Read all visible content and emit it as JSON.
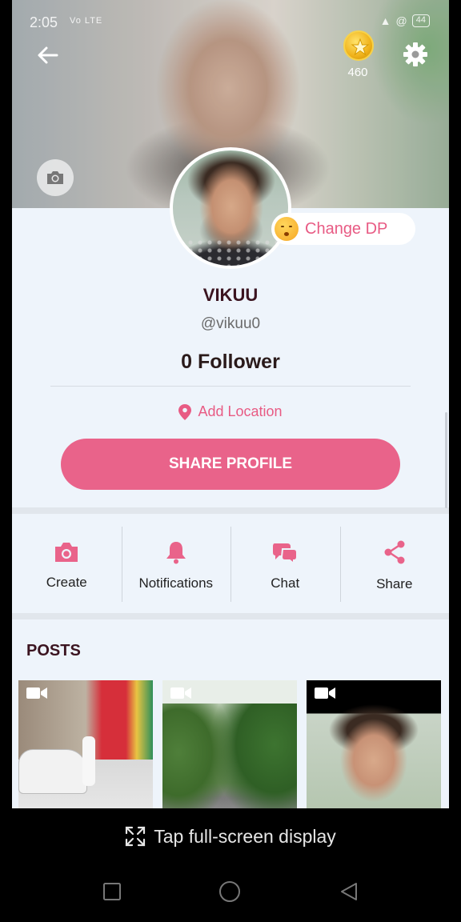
{
  "status_bar": {
    "time": "2:05",
    "signal_text": "Vo LTE",
    "battery": "44"
  },
  "header": {
    "coins": "460"
  },
  "profile": {
    "change_dp_label": "Change DP",
    "name": "VIKUU",
    "handle": "@vikuu0",
    "followers": "0 Follower",
    "location_label": "Add Location",
    "share_button": "SHARE PROFILE"
  },
  "actions": [
    {
      "label": "Create",
      "icon": "camera-icon"
    },
    {
      "label": "Notifications",
      "icon": "bell-icon"
    },
    {
      "label": "Chat",
      "icon": "chat-icon"
    },
    {
      "label": "Share",
      "icon": "share-icon"
    }
  ],
  "posts": {
    "title": "POSTS"
  },
  "overlay": {
    "fullscreen_label": "Tap full-screen display"
  },
  "colors": {
    "accent": "#e9638a",
    "accent_text": "#e85b84",
    "background": "#eef4fb",
    "title": "#3b1420"
  }
}
